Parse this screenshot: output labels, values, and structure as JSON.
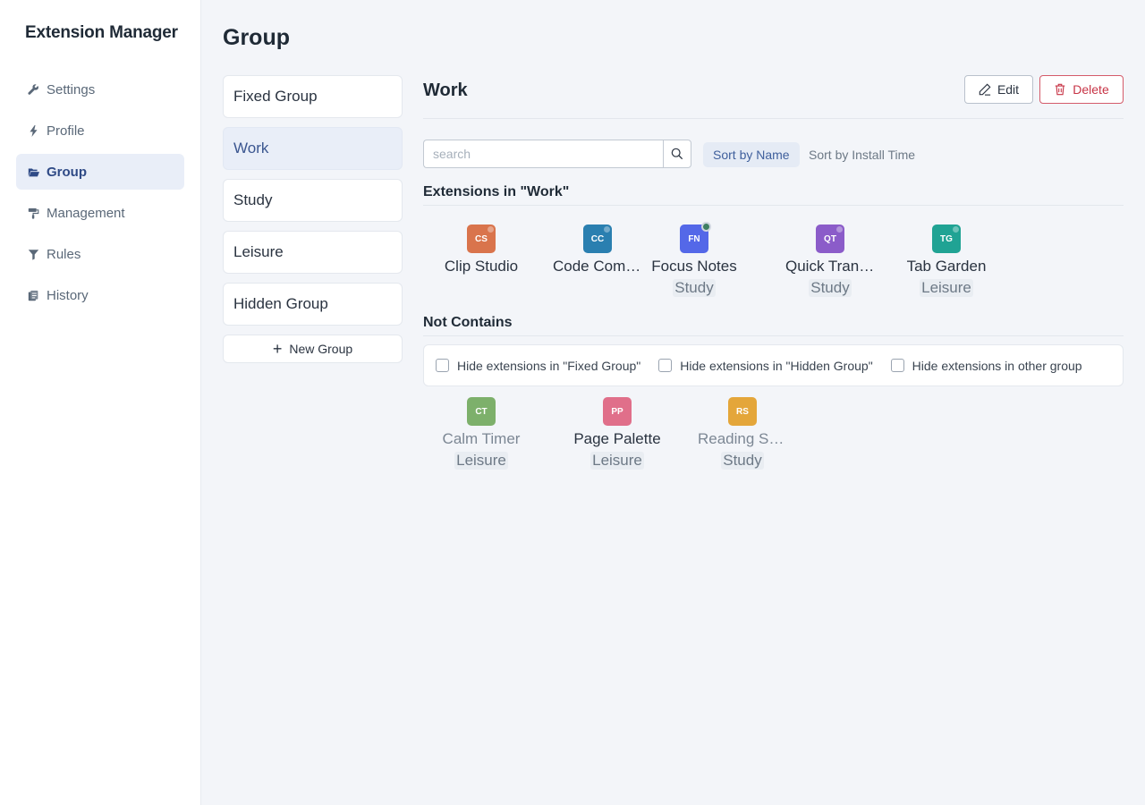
{
  "app": {
    "title": "Extension Manager"
  },
  "sidebar": {
    "items": [
      {
        "label": "Settings",
        "icon": "wrench-icon",
        "active": false
      },
      {
        "label": "Profile",
        "icon": "bolt-icon",
        "active": false
      },
      {
        "label": "Group",
        "icon": "folder-open-icon",
        "active": true
      },
      {
        "label": "Management",
        "icon": "paint-roller-icon",
        "active": false
      },
      {
        "label": "Rules",
        "icon": "funnel-icon",
        "active": false
      },
      {
        "label": "History",
        "icon": "history-icon",
        "active": false
      }
    ]
  },
  "page": {
    "title": "Group"
  },
  "groups": {
    "items": [
      {
        "label": "Fixed Group"
      },
      {
        "label": "Work",
        "active": true
      },
      {
        "label": "Study"
      },
      {
        "label": "Leisure"
      },
      {
        "label": "Hidden Group"
      }
    ],
    "new_label": "New Group"
  },
  "detail": {
    "title": "Work",
    "edit_label": "Edit",
    "delete_label": "Delete",
    "search_placeholder": "search",
    "sort_name_label": "Sort by Name",
    "sort_time_label": "Sort by Install Time",
    "in_group_title": "Extensions in \"Work\"",
    "not_contains_title": "Not Contains",
    "in_group": [
      {
        "initials": "CS",
        "name": "Clip Studio",
        "color": "#d9744c",
        "enabled": false,
        "tag": ""
      },
      {
        "initials": "CC",
        "name": "Code Comments",
        "color": "#2a7fb0",
        "enabled": false,
        "tag": ""
      },
      {
        "initials": "FN",
        "name": "Focus Notes",
        "color": "#5468e8",
        "enabled": true,
        "tag": "Study"
      },
      {
        "initials": "QT",
        "name": "Quick Translate",
        "color": "#8b5cc9",
        "enabled": false,
        "tag": "Study"
      },
      {
        "initials": "TG",
        "name": "Tab Garden",
        "color": "#20a394",
        "enabled": false,
        "tag": "Leisure"
      }
    ],
    "filters": [
      {
        "label": "Hide extensions in \"Fixed Group\"",
        "checked": false
      },
      {
        "label": "Hide extensions in \"Hidden Group\"",
        "checked": false
      },
      {
        "label": "Hide extensions in other group",
        "checked": false
      }
    ],
    "not_in_group": [
      {
        "initials": "CT",
        "name": "Calm Timer",
        "color": "#7db06b",
        "dim": true,
        "tag": "Leisure"
      },
      {
        "initials": "PP",
        "name": "Page Palette",
        "color": "#e06f8a",
        "dim": false,
        "tag": "Leisure"
      },
      {
        "initials": "RS",
        "name": "Reading Shelf",
        "color": "#e4a63a",
        "dim": true,
        "tag": "Study"
      }
    ]
  }
}
